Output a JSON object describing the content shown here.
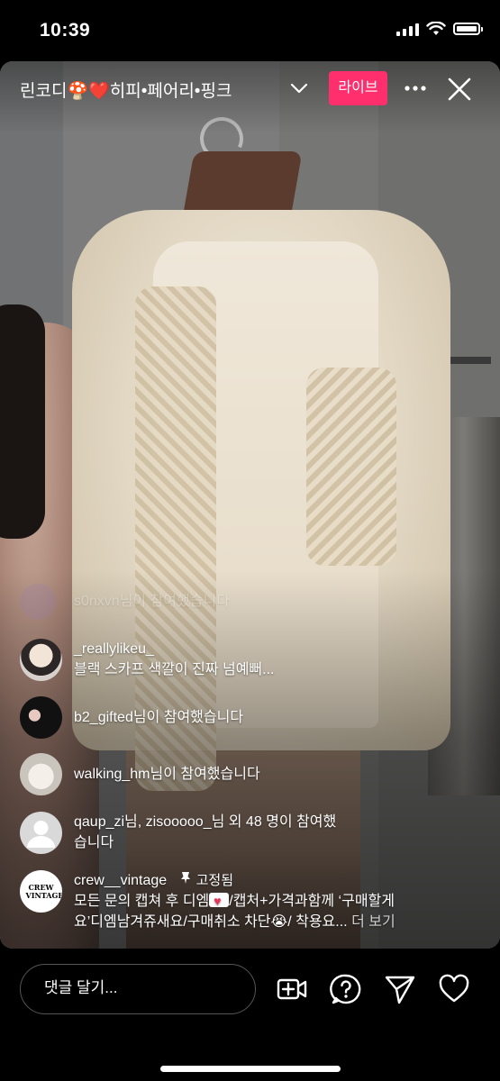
{
  "status_bar": {
    "time": "10:39"
  },
  "header": {
    "title": "린코디🍄❤️히피•페어리•핑크",
    "live_label": "라이브",
    "icons": [
      "chevron-down-icon",
      "more-icon",
      "close-icon"
    ]
  },
  "comments": [
    {
      "username": "s0nxvn",
      "text": "님이 참여했습니다",
      "faded": true
    },
    {
      "username": "_reallylikeu_",
      "text": "블랙 스카프 색깔이 진짜 넘예뻐..."
    },
    {
      "username": "b2_gifted",
      "text": "님이 참여했습니다"
    },
    {
      "username": "walking_hm",
      "text": "님이 참여했습니다"
    },
    {
      "username": "qaup_zi",
      "text": "님, zisooooo_님 외 48 명이 참여했습니다"
    },
    {
      "username": "crew__vintage",
      "pinned_label": "고정됨",
      "text_line1_a": "모든 문의 캡쳐 후 디엠",
      "text_line1_b": "/캡처+가격과함께 ‘구매할게",
      "text_line2": "요’디엠남겨쥬새요/구매취소 차단😭/ 착용요...",
      "more_label": "더 보기",
      "avatar_text": "CREW VINTAGE"
    }
  ],
  "bottom_bar": {
    "placeholder": "댓글 달기...",
    "icons": [
      "add-video-icon",
      "question-icon",
      "send-icon",
      "heart-icon"
    ]
  },
  "colors": {
    "live": "#ff2f6d",
    "background": "#000000"
  }
}
